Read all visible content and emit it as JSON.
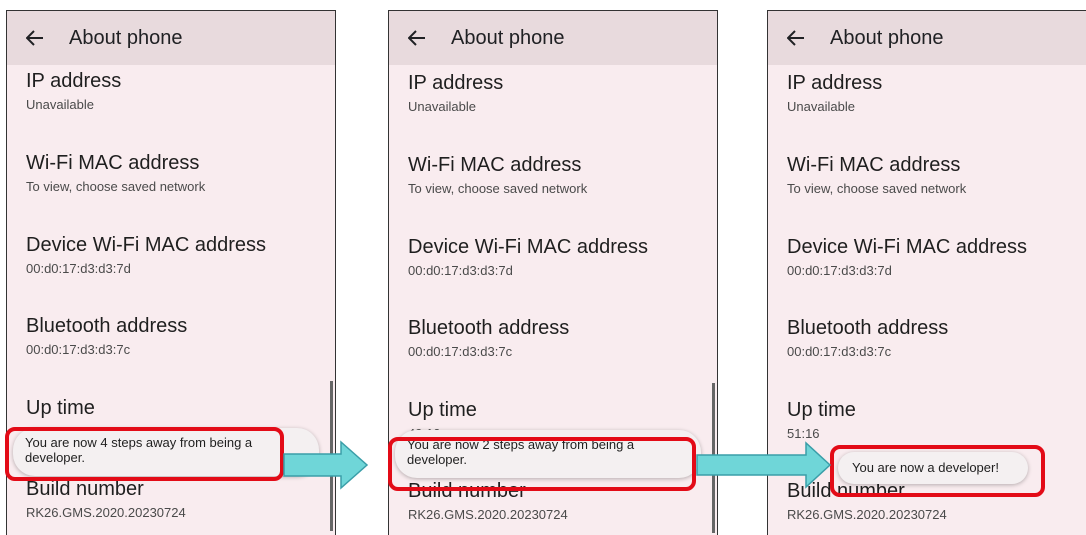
{
  "screens": [
    {
      "appbar_title": "About phone",
      "back_icon": "arrow-left-icon",
      "items": [
        {
          "title": "IP address",
          "summary": "Unavailable"
        },
        {
          "title": "Wi-Fi MAC address",
          "summary": "To view, choose saved network"
        },
        {
          "title": "Device Wi-Fi MAC address",
          "summary": "00:d0:17:d3:d3:7d"
        },
        {
          "title": "Bluetooth address",
          "summary": "00:d0:17:d3:d3:7c"
        },
        {
          "title": "Up time",
          "summary": ""
        },
        {
          "title": "Build number",
          "summary": "RK26.GMS.2020.20230724"
        }
      ],
      "toast": "You are now 4 steps away from being a developer."
    },
    {
      "appbar_title": "About phone",
      "back_icon": "arrow-left-icon",
      "items": [
        {
          "title": "IP address",
          "summary": "Unavailable"
        },
        {
          "title": "Wi-Fi MAC address",
          "summary": "To view, choose saved network"
        },
        {
          "title": "Device Wi-Fi MAC address",
          "summary": "00:d0:17:d3:d3:7d"
        },
        {
          "title": "Bluetooth address",
          "summary": "00:d0:17:d3:d3:7c"
        },
        {
          "title": "Up time",
          "summary": "49:10"
        },
        {
          "title": "Build number",
          "summary": "RK26.GMS.2020.20230724"
        }
      ],
      "toast": "You are now 2 steps away from being a developer."
    },
    {
      "appbar_title": "About phone",
      "back_icon": "arrow-left-icon",
      "items": [
        {
          "title": "IP address",
          "summary": "Unavailable"
        },
        {
          "title": "Wi-Fi MAC address",
          "summary": "To view, choose saved network"
        },
        {
          "title": "Device Wi-Fi MAC address",
          "summary": "00:d0:17:d3:d3:7d"
        },
        {
          "title": "Bluetooth address",
          "summary": "00:d0:17:d3:d3:7c"
        },
        {
          "title": "Up time",
          "summary": "51:16"
        },
        {
          "title": "Build number",
          "summary": "RK26.GMS.2020.20230724"
        }
      ],
      "toast": "You are now a developer!"
    }
  ],
  "colors": {
    "highlight": "#e30b17",
    "arrow_fill": "#6fd6d8",
    "arrow_stroke": "#3a9ea8",
    "screen_bg": "#f9ecef",
    "appbar_bg": "#e8dadd"
  }
}
